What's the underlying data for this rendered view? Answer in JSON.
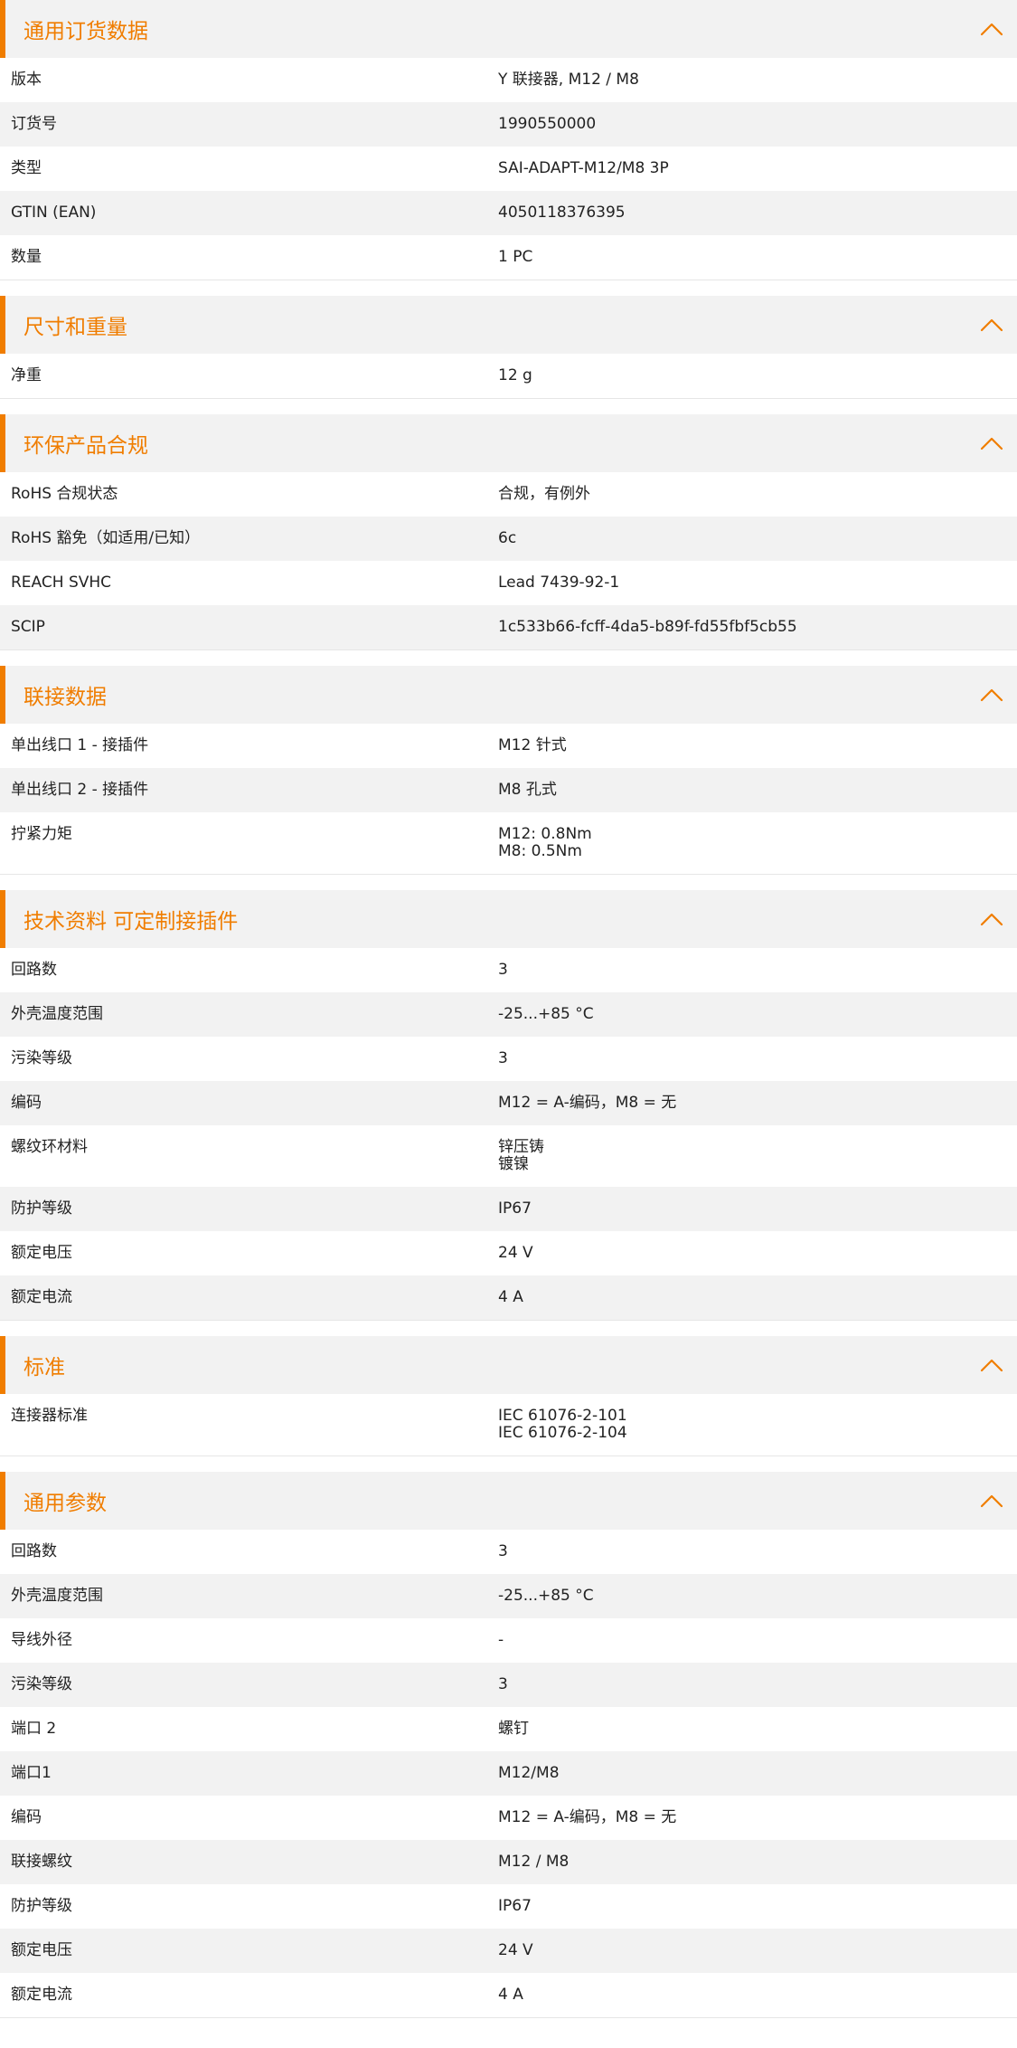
{
  "colors": {
    "accent": "#f07d00",
    "stripe": "#f2f2f2"
  },
  "icons": {
    "collapse": "chevron-up-icon"
  },
  "sections": [
    {
      "title": "通用订货数据",
      "rows": [
        {
          "label": "版本",
          "value": "Y 联接器, M12 / M8"
        },
        {
          "label": "订货号",
          "value": "1990550000"
        },
        {
          "label": "类型",
          "value": "SAI-ADAPT-M12/M8 3P"
        },
        {
          "label": "GTIN (EAN)",
          "value": "4050118376395"
        },
        {
          "label": "数量",
          "value": "1  PC"
        }
      ]
    },
    {
      "title": "尺寸和重量",
      "rows": [
        {
          "label": "净重",
          "value": "12  g"
        }
      ]
    },
    {
      "title": "环保产品合规",
      "rows": [
        {
          "label": "RoHS 合规状态",
          "value": "合规，有例外"
        },
        {
          "label": "RoHS 豁免（如适用/已知）",
          "value": "6c"
        },
        {
          "label": "REACH SVHC",
          "value": "Lead 7439-92-1"
        },
        {
          "label": "SCIP",
          "value": "1c533b66-fcff-4da5-b89f-fd55fbf5cb55"
        }
      ]
    },
    {
      "title": "联接数据",
      "rows": [
        {
          "label": "单出线口 1 - 接插件",
          "value": "M12 针式"
        },
        {
          "label": "单出线口 2 - 接插件",
          "value": "M8 孔式"
        },
        {
          "label": "拧紧力矩",
          "value": "M12: 0.8Nm\nM8: 0.5Nm"
        }
      ]
    },
    {
      "title": "技术资料 可定制接插件",
      "rows": [
        {
          "label": "回路数",
          "value": "3"
        },
        {
          "label": "外壳温度范围",
          "value": "-25...+85 °C"
        },
        {
          "label": "污染等级",
          "value": "3"
        },
        {
          "label": "编码",
          "value": "M12 = A-编码，M8 = 无"
        },
        {
          "label": "螺纹环材料",
          "value": "锌压铸\n镀镍"
        },
        {
          "label": "防护等级",
          "value": "IP67"
        },
        {
          "label": "额定电压",
          "value": "24  V"
        },
        {
          "label": "额定电流",
          "value": "4  A"
        }
      ]
    },
    {
      "title": "标准",
      "rows": [
        {
          "label": "连接器标准",
          "value": "IEC 61076-2-101\nIEC 61076-2-104"
        }
      ]
    },
    {
      "title": "通用参数",
      "rows": [
        {
          "label": "回路数",
          "value": "3"
        },
        {
          "label": "外壳温度范围",
          "value": "-25...+85 °C"
        },
        {
          "label": "导线外径",
          "value": "-"
        },
        {
          "label": "污染等级",
          "value": "3"
        },
        {
          "label": "端口 2",
          "value": "螺钉"
        },
        {
          "label": "端口1",
          "value": "M12/M8"
        },
        {
          "label": "编码",
          "value": "M12 = A-编码，M8 = 无"
        },
        {
          "label": "联接螺纹",
          "value": "M12 / M8"
        },
        {
          "label": "防护等级",
          "value": "IP67"
        },
        {
          "label": "额定电压",
          "value": "24  V"
        },
        {
          "label": "额定电流",
          "value": "4  A"
        }
      ]
    }
  ]
}
